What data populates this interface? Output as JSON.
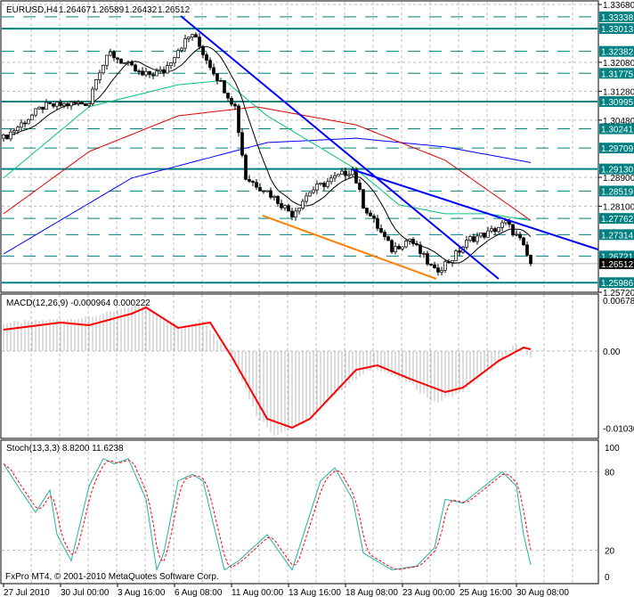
{
  "header": {
    "symbol": "EURUSD,H4",
    "open": "1.26467",
    "high": "1.26589",
    "low": "1.26432",
    "close": "1.26512"
  },
  "macd": {
    "label": "MACD(12,26,9) -0.000964 0.000222",
    "axis": [
      "0.00678",
      "0.00",
      "-0.01030"
    ]
  },
  "stoch": {
    "label": "Stoch(13,3,3) 8.8200 11.6238",
    "axis": [
      "100",
      "80",
      "20",
      "0"
    ]
  },
  "copyright": "FxPro MT4, © 2001-2010 MetaQuotes Software Corp.",
  "colors": {
    "level": "#008080",
    "trend": "#0000ff",
    "support": "#ff8000",
    "ma_fast": "#000000",
    "ma_green": "#00c080",
    "ma_red": "#e00000",
    "ma_blue": "#0000ff",
    "macd_signal": "#ff0000",
    "stoch_main": "#20b2aa",
    "stoch_signal": "#ff0000"
  },
  "chart_data": [
    {
      "type": "candlestick",
      "title": "EURUSD,H4",
      "ylim": [
        1.2572,
        1.3368
      ],
      "price_axis_ticks": [
        "1.33680",
        "1.32080",
        "1.31280",
        "1.30480",
        "1.28900",
        "1.28100",
        "1.25720"
      ],
      "current_price": "1.26512",
      "time_labels": [
        "27 Jul 2010",
        "30 Jul 00:00",
        "3 Aug 16:00",
        "6 Aug 08:00",
        "11 Aug 00:00",
        "13 Aug 16:00",
        "18 Aug 08:00",
        "23 Aug 00:00",
        "25 Aug 16:00",
        "30 Aug 08:00"
      ],
      "close_keypoints": [
        [
          0,
          1.2998
        ],
        [
          11,
          1.3085
        ],
        [
          24,
          1.3097
        ],
        [
          26,
          1.3171
        ],
        [
          30,
          1.3232
        ],
        [
          39,
          1.3171
        ],
        [
          45,
          1.3183
        ],
        [
          49,
          1.3245
        ],
        [
          53,
          1.3287
        ],
        [
          59,
          1.3183
        ],
        [
          65,
          1.3085
        ],
        [
          68,
          1.2888
        ],
        [
          74,
          1.2851
        ],
        [
          81,
          1.2789
        ],
        [
          86,
          1.2851
        ],
        [
          93,
          1.2888
        ],
        [
          98,
          1.2912
        ],
        [
          101,
          1.2814
        ],
        [
          109,
          1.269
        ],
        [
          114,
          1.272
        ],
        [
          121,
          1.2629
        ],
        [
          126,
          1.2666
        ],
        [
          131,
          1.272
        ],
        [
          136,
          1.2735
        ],
        [
          141,
          1.2764
        ],
        [
          145,
          1.2715
        ],
        [
          148,
          1.2651
        ]
      ],
      "ma_green_keypoints": [
        [
          0,
          1.2888
        ],
        [
          24,
          1.3085
        ],
        [
          49,
          1.3146
        ],
        [
          62,
          1.3158
        ],
        [
          74,
          1.306
        ],
        [
          99,
          1.2912
        ],
        [
          111,
          1.2814
        ],
        [
          124,
          1.2789
        ],
        [
          136,
          1.2789
        ],
        [
          149,
          1.2769
        ]
      ],
      "ma_red_keypoints": [
        [
          0,
          1.2789
        ],
        [
          24,
          1.2961
        ],
        [
          49,
          1.306
        ],
        [
          71,
          1.3085
        ],
        [
          99,
          1.3035
        ],
        [
          124,
          1.2937
        ],
        [
          149,
          1.2764
        ]
      ],
      "ma_blue_keypoints": [
        [
          0,
          1.2678
        ],
        [
          36,
          1.2888
        ],
        [
          74,
          1.2986
        ],
        [
          99,
          1.2998
        ],
        [
          124,
          1.2974
        ],
        [
          149,
          1.2929
        ]
      ],
      "levels": [
        {
          "price": "1.33338",
          "style": "dashed"
        },
        {
          "price": "1.33013",
          "style": "solid"
        },
        {
          "price": "1.32382",
          "style": "dashed"
        },
        {
          "price": "1.31775",
          "style": "dashed"
        },
        {
          "price": "1.30995",
          "style": "solid"
        },
        {
          "price": "1.30241",
          "style": "dashed"
        },
        {
          "price": "1.29709",
          "style": "dashed"
        },
        {
          "price": "1.29130",
          "style": "solid"
        },
        {
          "price": "1.28519",
          "style": "dashed"
        },
        {
          "price": "1.27762",
          "style": "dashed"
        },
        {
          "price": "1.27314",
          "style": "dashed"
        },
        {
          "price": "1.26721",
          "style": "dashed"
        },
        {
          "price": "1.25986",
          "style": "solid"
        }
      ],
      "trendlines": [
        {
          "color": "trend",
          "from": [
            49.75,
            1.3336
          ],
          "to": [
            139,
            1.2609
          ]
        },
        {
          "color": "trend",
          "from": [
            97.75,
            1.2912
          ],
          "to": [
            167,
            1.269
          ]
        },
        {
          "color": "support",
          "from": [
            72.75,
            1.2784
          ],
          "to": [
            121.5,
            1.2609
          ]
        }
      ]
    },
    {
      "type": "bar",
      "title": "MACD(12,26,9)",
      "ylim": [
        -0.0103,
        0.00678
      ],
      "histogram_keypoints": [
        [
          0,
          0.0035
        ],
        [
          24,
          0.0042
        ],
        [
          36,
          0.0055
        ],
        [
          40,
          0.0058
        ],
        [
          49,
          0.003
        ],
        [
          56,
          0.004
        ],
        [
          60,
          0.0015
        ],
        [
          64,
          -0.0005
        ],
        [
          71,
          -0.008
        ],
        [
          76,
          -0.0105
        ],
        [
          84,
          -0.009
        ],
        [
          94,
          -0.005
        ],
        [
          104,
          -0.002
        ],
        [
          114,
          -0.004
        ],
        [
          121,
          -0.0065
        ],
        [
          129,
          -0.005
        ],
        [
          139,
          -0.0015
        ],
        [
          144,
          0.001
        ],
        [
          148,
          -0.001
        ]
      ],
      "signal_keypoints": [
        [
          0,
          0.00267
        ],
        [
          16,
          0.00356
        ],
        [
          24,
          0.00322
        ],
        [
          36,
          0.00467
        ],
        [
          40,
          0.00544
        ],
        [
          49,
          0.00289
        ],
        [
          58,
          0.00356
        ],
        [
          64,
          -0.00067
        ],
        [
          74,
          -0.00844
        ],
        [
          81,
          -0.00956
        ],
        [
          86,
          -0.00844
        ],
        [
          99,
          -0.00233
        ],
        [
          105,
          -0.00178
        ],
        [
          114,
          -0.00344
        ],
        [
          124,
          -0.00511
        ],
        [
          129,
          -0.00456
        ],
        [
          139,
          -0.00122
        ],
        [
          146,
          0.00044
        ],
        [
          148,
          0.00022
        ]
      ]
    },
    {
      "type": "line",
      "title": "Stoch(13,3,3)",
      "ylim": [
        0,
        100
      ],
      "main_keypoints": [
        [
          0,
          86
        ],
        [
          4,
          69
        ],
        [
          9,
          49
        ],
        [
          13,
          66
        ],
        [
          15,
          32
        ],
        [
          19,
          12
        ],
        [
          24,
          69
        ],
        [
          28,
          90
        ],
        [
          31,
          86
        ],
        [
          35,
          90
        ],
        [
          40,
          59
        ],
        [
          43,
          5
        ],
        [
          45,
          18
        ],
        [
          49,
          73
        ],
        [
          53,
          78
        ],
        [
          56,
          73
        ],
        [
          62,
          5
        ],
        [
          66,
          12
        ],
        [
          74,
          32
        ],
        [
          81,
          5
        ],
        [
          85,
          39
        ],
        [
          89,
          73
        ],
        [
          93,
          83
        ],
        [
          98,
          59
        ],
        [
          101,
          18
        ],
        [
          109,
          5
        ],
        [
          116,
          8
        ],
        [
          121,
          22
        ],
        [
          124,
          59
        ],
        [
          129,
          56
        ],
        [
          135,
          69
        ],
        [
          140,
          80
        ],
        [
          144,
          69
        ],
        [
          146,
          32
        ],
        [
          148,
          8.82
        ]
      ]
    }
  ]
}
